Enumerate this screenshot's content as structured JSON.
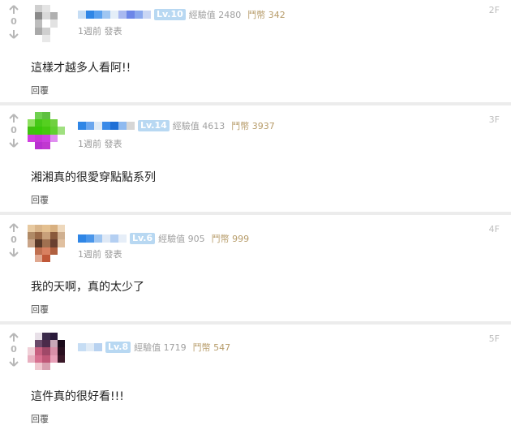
{
  "posts": [
    {
      "floor": "2F",
      "score": "0",
      "level": "Lv.10",
      "exp_label": "經驗值",
      "exp": "2480",
      "coin_label": "鬥幣",
      "coins": "342",
      "time": "1週前 發表",
      "content": "這樣才越多人看阿!!",
      "reply": "回覆"
    },
    {
      "floor": "3F",
      "score": "0",
      "level": "Lv.14",
      "exp_label": "經驗值",
      "exp": "4613",
      "coin_label": "鬥幣",
      "coins": "3937",
      "time": "1週前 發表",
      "content": "湘湘真的很愛穿點點系列",
      "reply": "回覆"
    },
    {
      "floor": "4F",
      "score": "0",
      "level": "Lv.6",
      "exp_label": "經驗值",
      "exp": "905",
      "coin_label": "鬥幣",
      "coins": "999",
      "time": "1週前 發表",
      "content": "我的天啊，真的太少了",
      "reply": "回覆"
    },
    {
      "floor": "5F",
      "score": "0",
      "level": "Lv.8",
      "exp_label": "經驗值",
      "exp": "1719",
      "coin_label": "鬥幣",
      "coins": "547",
      "time": "1週前 發表",
      "content": "這件真的很好看!!!",
      "reply": "回覆"
    }
  ],
  "icons": {
    "upvote": "arrow-up-icon",
    "downvote": "arrow-down-icon"
  },
  "colors": {
    "level_badge": "#b8d8f2",
    "coin_text": "#b79c6a",
    "background": "#ececec"
  }
}
